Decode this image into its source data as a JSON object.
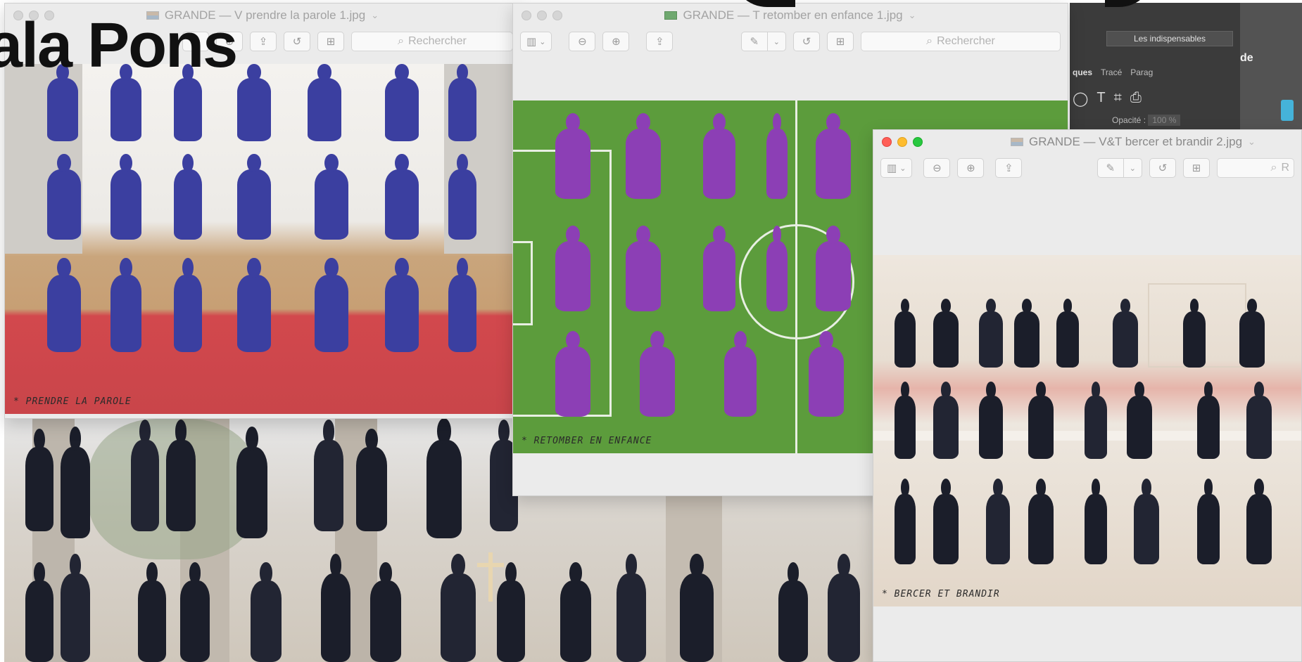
{
  "presentation": {
    "title_fragment": "ala Pons"
  },
  "windows": {
    "prendre": {
      "title": "GRANDE — V prendre la parole 1.jpg",
      "search_placeholder": "Rechercher",
      "caption": "* PRENDRE LA PAROLE"
    },
    "retomber": {
      "title": "GRANDE — T retomber en enfance 1.jpg",
      "search_placeholder": "Rechercher",
      "caption": "* RETOMBER EN ENFANCE"
    },
    "bercer": {
      "title": "GRANDE — V&T bercer et brandir 2.jpg",
      "search_placeholder": "R",
      "caption": "* BERCER ET BRANDIR"
    }
  },
  "photoshop": {
    "workspace": "Les indispensables",
    "tabs": [
      "ques",
      "Tracé",
      "Parag"
    ],
    "opacity_label": "Opacité :",
    "opacity_value": "100 %",
    "right_text": "de"
  },
  "icons": {
    "sidebar": "sidebar-toggle-icon",
    "zoom_out": "zoom-out-icon",
    "zoom_in": "zoom-in-icon",
    "share": "share-icon",
    "markup": "markup-pen-icon",
    "rotate": "rotate-icon",
    "toolbox": "toolbox-icon",
    "search": "search-icon"
  },
  "colors": {
    "close": "#ff5f57",
    "minimize": "#febc2e",
    "zoom": "#28c840",
    "theater_wall": "#f2f0ee",
    "theater_floor": "#c8a47a",
    "seats": "#d9454a",
    "figure_blue": "#3b3fa0",
    "grass": "#5a9a3a",
    "figure_purple": "#8c3fb5",
    "kitchen": "#e9ded2",
    "suit": "#1b1e2a"
  }
}
